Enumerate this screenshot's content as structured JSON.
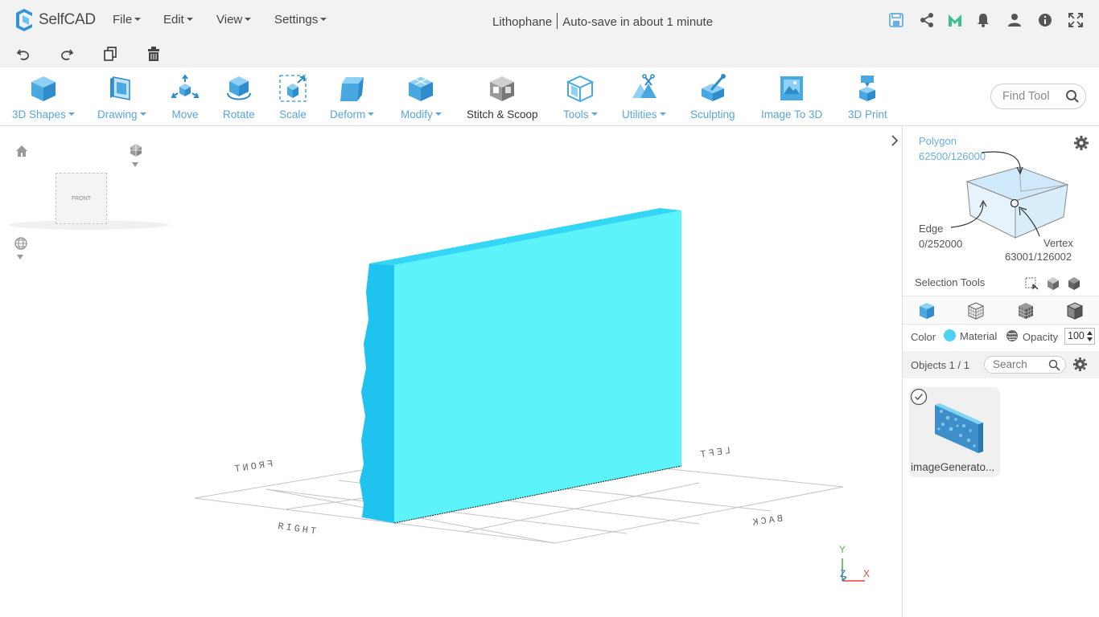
{
  "app": {
    "name": "SelfCAD"
  },
  "menu": {
    "file": "File",
    "edit": "Edit",
    "view": "View",
    "settings": "Settings"
  },
  "document": {
    "title": "Lithophane",
    "autosave": "Auto-save in about 1 minute"
  },
  "top_icons": [
    "save-icon",
    "share-icon",
    "m-logo-icon",
    "bell-icon",
    "user-icon",
    "info-icon",
    "fullscreen-icon"
  ],
  "quick_actions": [
    "undo-icon",
    "redo-icon",
    "copy-icon",
    "delete-icon"
  ],
  "ribbon": {
    "tools": [
      {
        "label": "3D Shapes",
        "icon": "cube-icon",
        "dropdown": true
      },
      {
        "label": "Drawing",
        "icon": "drawing-icon",
        "dropdown": true
      },
      {
        "label": "Move",
        "icon": "move-icon",
        "dropdown": false
      },
      {
        "label": "Rotate",
        "icon": "rotate-icon",
        "dropdown": false
      },
      {
        "label": "Scale",
        "icon": "scale-icon",
        "dropdown": false
      },
      {
        "label": "Deform",
        "icon": "deform-icon",
        "dropdown": true
      },
      {
        "label": "Modify",
        "icon": "modify-icon",
        "dropdown": true
      },
      {
        "label": "Stitch & Scoop",
        "icon": "stitch-scoop-icon",
        "dropdown": false
      },
      {
        "label": "Tools",
        "icon": "tools-icon",
        "dropdown": true
      },
      {
        "label": "Utilities",
        "icon": "utilities-icon",
        "dropdown": true
      },
      {
        "label": "Sculpting",
        "icon": "sculpting-icon",
        "dropdown": false
      },
      {
        "label": "Image To 3D",
        "icon": "image-to-3d-icon",
        "dropdown": false
      },
      {
        "label": "3D Print",
        "icon": "3d-print-icon",
        "dropdown": false
      }
    ],
    "find_tool_placeholder": "Find Tool"
  },
  "viewport": {
    "view_cube_label": "FRONT",
    "grid_labels": [
      "FRONT",
      "RIGHT",
      "LEFT",
      "BACK"
    ],
    "axes": {
      "x": "X",
      "y": "Y",
      "z": "Z"
    },
    "colors": {
      "object": "#5cf3fa",
      "object_side": "#1ec3f0",
      "object_top": "#33d7f5",
      "axis_x": "#e0443c",
      "axis_y": "#55b047",
      "axis_z": "#3a6fd6"
    }
  },
  "selection_panel": {
    "polygon_label": "Polygon",
    "polygon_count": "62500/126000",
    "edge_label": "Edge",
    "edge_count": "0/252000",
    "vertex_label": "Vertex",
    "vertex_count": "63001/126002",
    "selection_tools_label": "Selection Tools"
  },
  "properties": {
    "color_label": "Color",
    "color_value": "#4dd2f5",
    "material_label": "Material",
    "opacity_label": "Opacity",
    "opacity_value": "100"
  },
  "objects": {
    "header": "Objects 1 / 1",
    "search_placeholder": "Search",
    "items": [
      {
        "name": "imageGenerato..."
      }
    ]
  }
}
